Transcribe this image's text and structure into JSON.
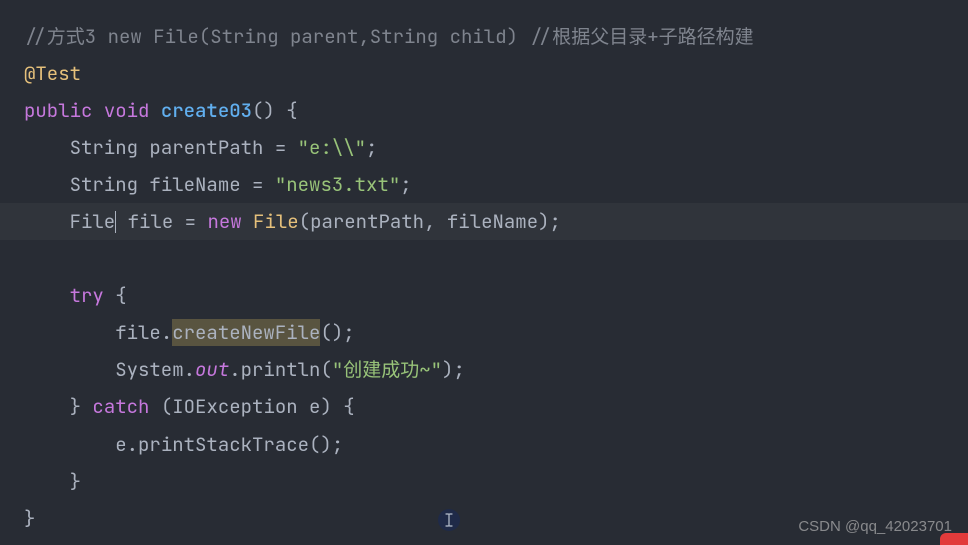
{
  "code": {
    "l1_comment": "//方式3 new File(String parent,String child) //根据父目录+子路径构建",
    "l2_annotation": "@Test",
    "l3": {
      "public": "public",
      "void": "void",
      "method": "create03",
      "parens": "()",
      "brace": " {"
    },
    "l4": {
      "indent": "    ",
      "type": "String",
      "ident": " parentPath ",
      "op": "= ",
      "str": "\"e:\\\\\"",
      "semi": ";"
    },
    "l5": {
      "indent": "    ",
      "type": "String",
      "ident": " fileName ",
      "op": "= ",
      "str": "\"news3.txt\"",
      "semi": ";"
    },
    "l6": {
      "indent": "    ",
      "type": "File",
      "ident": " file ",
      "op": "= ",
      "new": "new",
      "cls": " File",
      "open": "(",
      "a1": "parentPath",
      "comma": ", ",
      "a2": "fileName",
      "close": ");"
    },
    "l7": "",
    "l8": {
      "indent": "    ",
      "try": "try",
      "brace": " {"
    },
    "l9": {
      "indent": "        ",
      "obj": "file",
      "dot": ".",
      "method": "createNewFile",
      "tail": "();"
    },
    "l10": {
      "indent": "        ",
      "sys": "System",
      "dot1": ".",
      "out": "out",
      "dot2": ".",
      "println": "println",
      "open": "(",
      "str": "\"创建成功~\"",
      "close": ");"
    },
    "l11": {
      "indent": "    ",
      "close": "} ",
      "catch": "catch",
      "open": " (",
      "exc": "IOException",
      "var": " e",
      "close2": ") {"
    },
    "l12": {
      "indent": "        ",
      "obj": "e",
      "dot": ".",
      "method": "printStackTrace",
      "tail": "();"
    },
    "l13": {
      "indent": "    ",
      "close": "}"
    },
    "l14": {
      "close": "}"
    }
  },
  "watermark": "CSDN @qq_42023701"
}
